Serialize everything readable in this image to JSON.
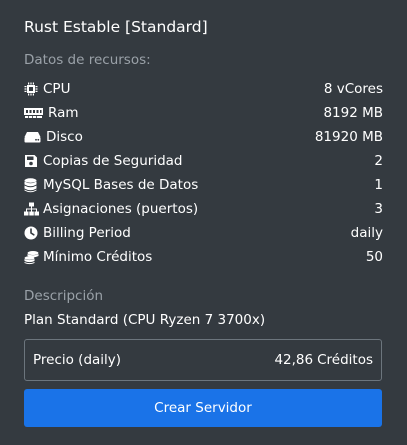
{
  "server": {
    "title": "Rust Estable [Standard]"
  },
  "resources": {
    "label": "Datos de recursos:",
    "items": [
      {
        "icon": "cpu-icon",
        "label": "CPU",
        "value": "8 vCores"
      },
      {
        "icon": "memory-icon",
        "label": "Ram",
        "value": "8192 MB"
      },
      {
        "icon": "hdd-icon",
        "label": "Disco",
        "value": "81920 MB"
      },
      {
        "icon": "floppy-disk-icon",
        "label": "Copias de Seguridad",
        "value": "2"
      },
      {
        "icon": "database-icon",
        "label": "MySQL Bases de Datos",
        "value": "1"
      },
      {
        "icon": "network-icon",
        "label": "Asignaciones (puertos)",
        "value": "3"
      },
      {
        "icon": "clock-icon",
        "label": "Billing Period",
        "value": "daily"
      },
      {
        "icon": "coins-icon",
        "label": "Mínimo Créditos",
        "value": "50"
      }
    ]
  },
  "description": {
    "label": "Descripción",
    "text": "Plan Standard (CPU Ryzen 7 3700x)"
  },
  "price": {
    "label": "Precio (daily)",
    "amount": "42,86",
    "currency": "Créditos"
  },
  "actions": {
    "create_label": "Crear Servidor"
  },
  "colors": {
    "background": "#343a40",
    "accent": "#1a73e8",
    "muted_text": "#9aa1a8"
  }
}
